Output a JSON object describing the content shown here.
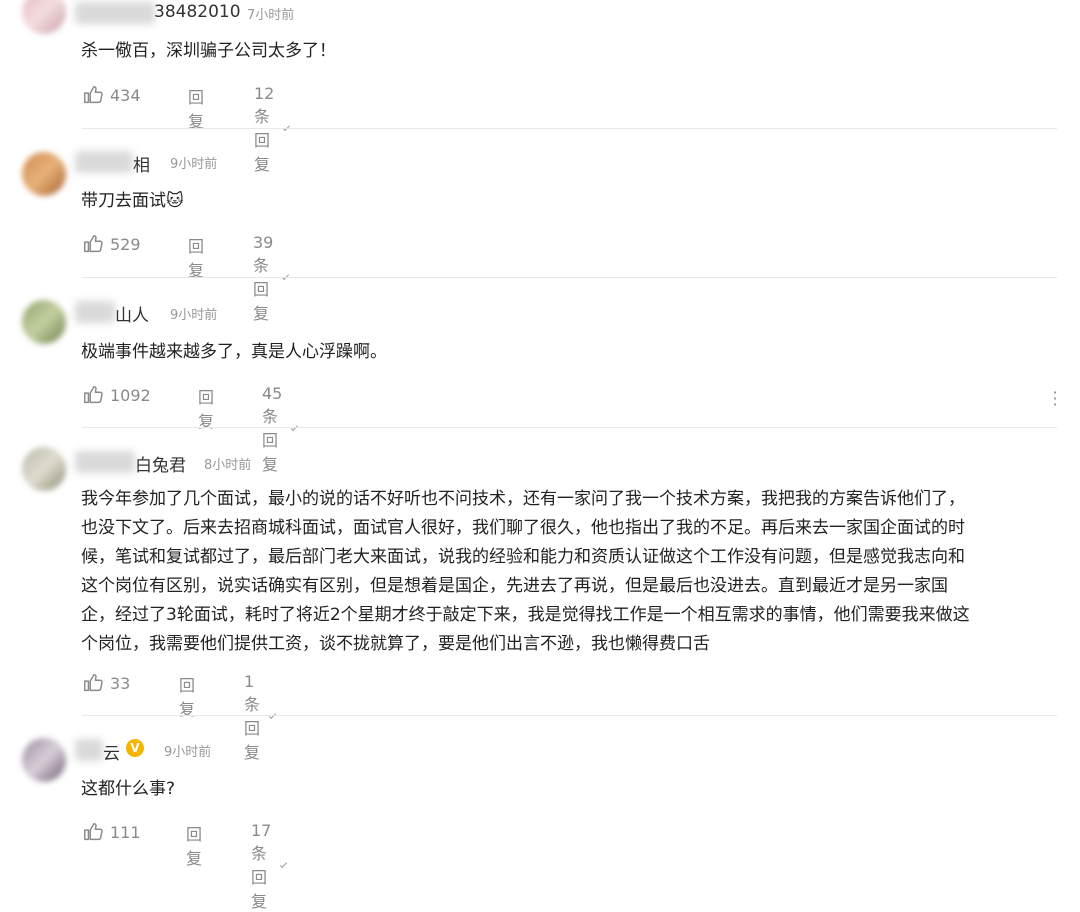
{
  "comments": [
    {
      "name": "38482010",
      "time": "7小时前",
      "text": "杀一儆百，深圳骗子公司太多了！",
      "likes": "434",
      "reply_label": "回复",
      "reply_count": "12条回复"
    },
    {
      "name": "相",
      "time": "9小时前",
      "text": "带刀去面试🐱",
      "likes": "529",
      "reply_label": "回复",
      "reply_count": "39条回复"
    },
    {
      "name": "山人",
      "time": "9小时前",
      "text": "极端事件越来越多了，真是人心浮躁啊。",
      "likes": "1092",
      "reply_label": "回复",
      "reply_count": "45条回复"
    },
    {
      "name": "白兔君",
      "time": "8小时前",
      "text_lines": [
        "我今年参加了几个面试，最小的说的话不好听也不问技术，还有一家问了我一个技术方案，我把我的方案告诉他们了，",
        "也没下文了。后来去招商城科面试，面试官人很好，我们聊了很久，他也指出了我的不足。再后来去一家国企面试的时",
        "候，笔试和复试都过了，最后部门老大来面试，说我的经验和能力和资质认证做这个工作没有问题，但是感觉我志向和",
        "这个岗位有区别，说实话确实有区别，但是想着是国企，先进去了再说，但是最后也没进去。直到最近才是另一家国",
        "企，经过了3轮面试，耗时了将近2个星期才终于敲定下来，我是觉得找工作是一个相互需求的事情，他们需要我来做这",
        "个岗位，我需要他们提供工资，谈不拢就算了，要是他们出言不逊，我也懒得费口舌"
      ],
      "likes": "33",
      "reply_label": "回复",
      "reply_count": "1条回复"
    },
    {
      "name": "云",
      "time": "9小时前",
      "badge": "V",
      "text": "这都什么事?",
      "likes": "111",
      "reply_label": "回复",
      "reply_count": "17条回复"
    }
  ],
  "more_icon": "vertical-dots-icon",
  "like_icon": "thumbs-up-icon",
  "colors": {
    "badge": "#f4b400",
    "muted": "#8a8a8a",
    "divider": "#e8e8e8"
  }
}
